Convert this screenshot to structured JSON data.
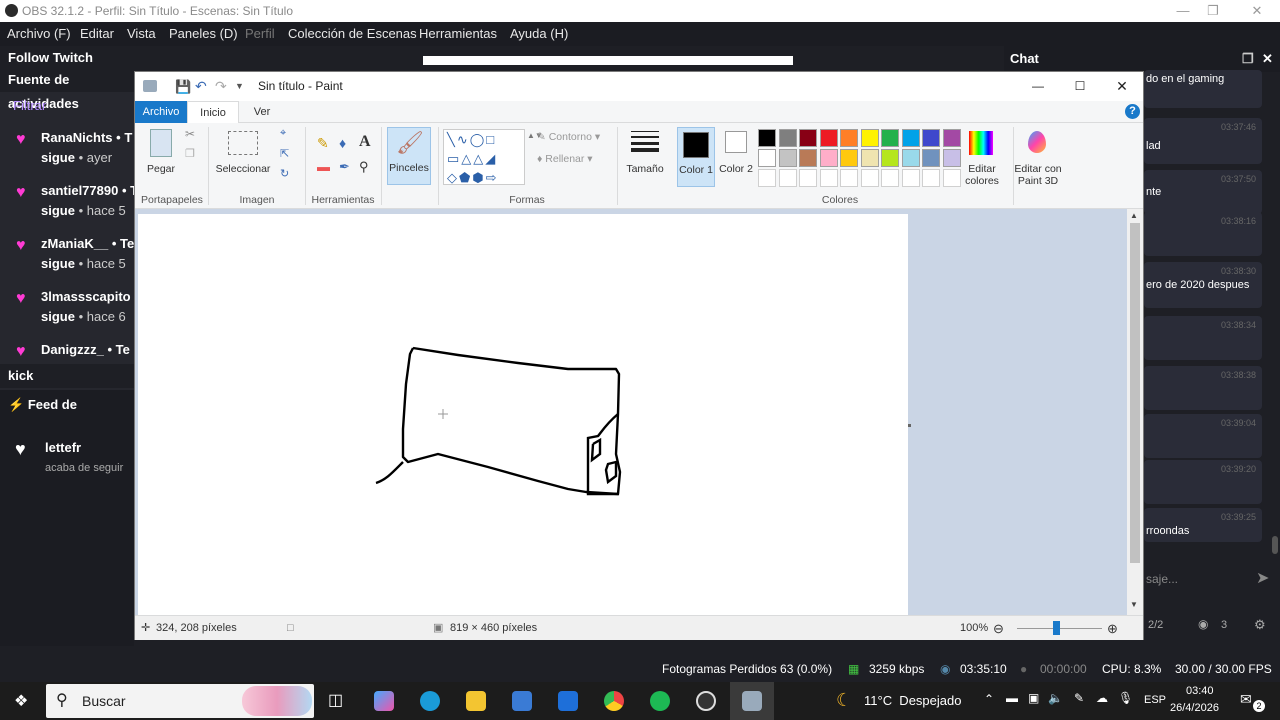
{
  "obs": {
    "title": "OBS 32.1.2 - Perfil: Sin Título - Escenas: Sin Título",
    "menu": [
      "Archivo (F)",
      "Editar",
      "Vista",
      "Paneles (D)",
      "Perfil",
      "Colección de Escenas",
      "Herramientas",
      "Ayuda (H)"
    ],
    "left_dock": {
      "follow_title": "Follow Twitch",
      "activity_title": "Fuente de actividades",
      "filter_label": "Filtrar",
      "items": [
        {
          "name": "RanaNichts",
          "suffix": "• T",
          "action": "sigue",
          "time": "• ayer"
        },
        {
          "name": "santiel77890",
          "suffix": "• T",
          "action": "sigue",
          "time": "• hace 5"
        },
        {
          "name": "zManiaK__",
          "suffix": "• Te",
          "action": "sigue",
          "time": "• hace 5"
        },
        {
          "name": "3lmassscapito",
          "suffix": "",
          "action": "sigue",
          "time": "• hace 6"
        },
        {
          "name": "Danigzzz_",
          "suffix": "• Te",
          "action": "",
          "time": ""
        }
      ],
      "kick_title": "kick",
      "kick_feed_title": "Feed de actividad",
      "kick_item": {
        "name": "lettefr",
        "action": "acaba de seguir"
      }
    },
    "chat": {
      "title": "Chat",
      "messages": [
        {
          "time": "",
          "text": "do en el gaming"
        },
        {
          "time": "03:37:46",
          "text": "lad"
        },
        {
          "time": "03:37:50",
          "text": "nte"
        },
        {
          "time": "03:38:16",
          "text": ""
        },
        {
          "time": "03:38:30",
          "text": "ero de 2020 despues"
        },
        {
          "time": "03:38:34",
          "text": ""
        },
        {
          "time": "03:38:38",
          "text": ""
        },
        {
          "time": "03:39:04",
          "text": ""
        },
        {
          "time": "03:39:20",
          "text": ""
        },
        {
          "time": "03:39:25",
          "text": "rroondas"
        }
      ],
      "input_placeholder": "saje...",
      "footer_page": "2/2",
      "footer_viewers": "3"
    },
    "status": {
      "dropped": "Fotogramas Perdidos 63 (0.0%)",
      "bitrate": "3259 kbps",
      "rec_time": "03:35:10",
      "stream_time": "00:00:00",
      "cpu": "CPU: 8.3%",
      "fps": "30.00 / 30.00 FPS"
    }
  },
  "paint": {
    "title": "Sin título - Paint",
    "tabs": {
      "archivo": "Archivo",
      "inicio": "Inicio",
      "ver": "Ver"
    },
    "ribbon": {
      "paste": "Pegar",
      "select": "Seleccionar",
      "brushes": "Pinceles",
      "outline": "Contorno",
      "fill": "Rellenar",
      "size": "Tamaño",
      "color1": "Color 1",
      "color2": "Color 2",
      "edit_colors": "Editar colores",
      "edit_3d": "Editar con Paint 3D",
      "groups": [
        "Portapapeles",
        "Imagen",
        "Herramientas",
        "Formas",
        "Colores"
      ]
    },
    "palette_row1": [
      "#000000",
      "#7f7f7f",
      "#880015",
      "#ed1c24",
      "#ff7f27",
      "#fff200",
      "#22b14c",
      "#00a2e8",
      "#3f48cc",
      "#a349a4"
    ],
    "palette_row2": [
      "#ffffff",
      "#c3c3c3",
      "#b97a57",
      "#ffaec9",
      "#ffc90e",
      "#efe4b0",
      "#b5e61d",
      "#99d9ea",
      "#7092be",
      "#c8bfe7"
    ],
    "status": {
      "cursor": "324, 208 píxeles",
      "size": "819 × 460 píxeles",
      "zoom": "100%"
    }
  },
  "taskbar": {
    "search": "Buscar",
    "weather": "11°C  Despejado",
    "lang": "ESP",
    "time": "03:40",
    "date": "26/4/2026",
    "notif_count": "2"
  }
}
